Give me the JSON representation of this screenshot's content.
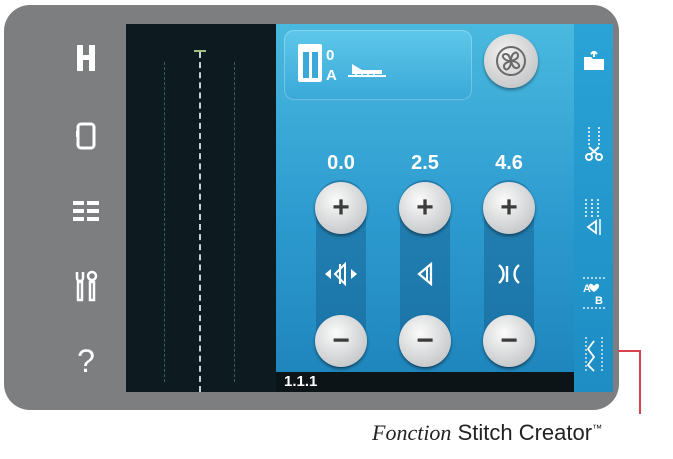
{
  "left_toolbar": {
    "items": [
      {
        "icon": "sewing-mode-icon"
      },
      {
        "icon": "embroidery-frame-icon"
      },
      {
        "icon": "menu-list-icon"
      },
      {
        "icon": "tools-settings-icon"
      },
      {
        "icon": "help-icon",
        "glyph": "?"
      }
    ]
  },
  "stitch_settings": {
    "values": [
      "0.0",
      "2.5",
      "4.6"
    ],
    "columns": [
      {
        "value": "0.0",
        "plus": "+",
        "minus": "−",
        "icon": "stitch-position-icon"
      },
      {
        "value": "2.5",
        "plus": "+",
        "minus": "−",
        "icon": "stitch-width-icon"
      },
      {
        "value": "4.6",
        "plus": "+",
        "minus": "−",
        "icon": "stitch-length-icon"
      }
    ]
  },
  "presser_foot": {
    "label_top": "0",
    "label_bottom": "A"
  },
  "status": {
    "stitch_number": "1.1.1"
  },
  "right_tabs": [
    {
      "icon": "file-folder-icon"
    },
    {
      "icon": "thread-cutter-icon"
    },
    {
      "icon": "stitch-mirror-icon"
    },
    {
      "icon": "alphabet-ab-icon"
    },
    {
      "icon": "stitch-creator-icon",
      "active": true
    }
  ],
  "caption": {
    "italic": "Fonction",
    "text": "Stitch Creator",
    "trademark": "™"
  },
  "colors": {
    "bezel": "#7d7e80",
    "panel": "#2d9bcf",
    "callout": "#d8424f"
  }
}
